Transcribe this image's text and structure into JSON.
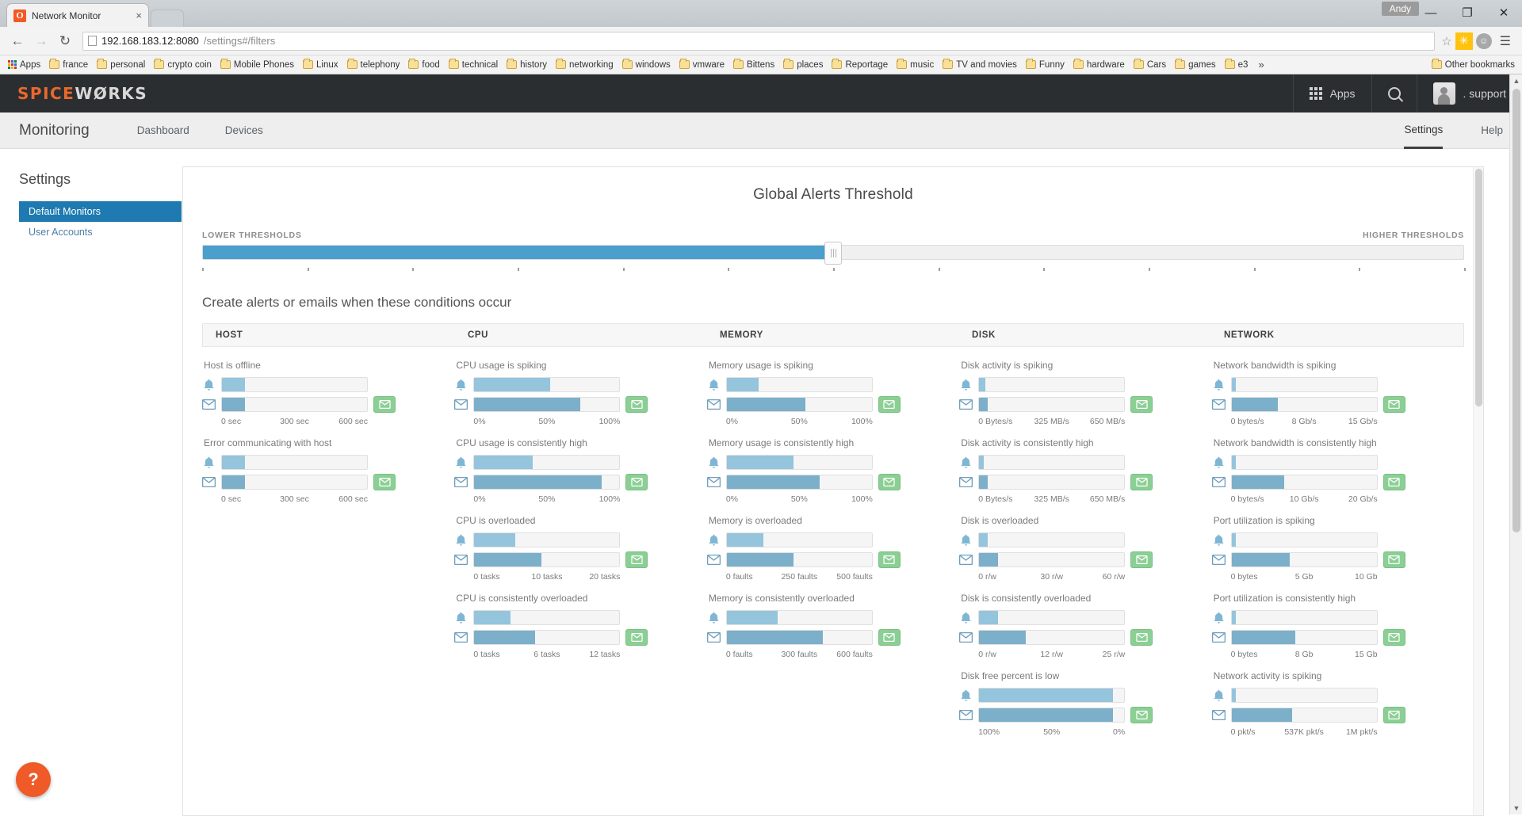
{
  "browser": {
    "tab_title": "Network Monitor",
    "tab_close": "×",
    "favicon_letter": "O",
    "window_user": "Andy",
    "minimize": "—",
    "maximize": "❐",
    "close": "✕",
    "back": "←",
    "forward": "→",
    "reload": "↻",
    "url_main": "192.168.183.12:8080",
    "url_dim": "/settings#/filters",
    "star": "☆",
    "ext_yellow_glyph": "✳",
    "ext_gray_glyph": "☺",
    "menu": "☰",
    "bookmarks": [
      "Apps",
      "france",
      "personal",
      "crypto coin",
      "Mobile Phones",
      "Linux",
      "telephony",
      "food",
      "technical",
      "history",
      "networking",
      "windows",
      "vmware",
      "Bittens",
      "places",
      "Reportage",
      "music",
      "TV and movies",
      "Funny",
      "hardware",
      "Cars",
      "games",
      "e3"
    ],
    "bookmarks_overflow": "»",
    "other_bookmarks": "Other bookmarks"
  },
  "sw_header": {
    "logo_orange": "SPICE",
    "logo_white": "WØRKS",
    "apps_label": "Apps",
    "search_label": "",
    "support_label": ". support"
  },
  "subnav": {
    "page_title": "Monitoring",
    "left_links": [
      "Dashboard",
      "Devices"
    ],
    "right_links": [
      "Settings",
      "Help"
    ]
  },
  "sidebar": {
    "title": "Settings",
    "items": [
      {
        "label": "Default Monitors",
        "selected": true
      },
      {
        "label": "User Accounts",
        "selected": false
      }
    ]
  },
  "panel": {
    "title": "Global Alerts Threshold",
    "slider": {
      "lower_label": "LOWER THRESHOLDS",
      "higher_label": "HIGHER THRESHOLDS",
      "value_percent": 50,
      "tick_count": 13,
      "fill_color": "#4a9fcc"
    },
    "conditions_heading": "Create alerts or emails when these conditions occur",
    "columns": [
      {
        "header": "HOST",
        "cards": [
          {
            "title": "Host is offline",
            "alert_percent": 16,
            "email_percent": 16,
            "scale": [
              "0 sec",
              "300 sec",
              "600 sec"
            ],
            "has_email_button": true
          },
          {
            "title": "Error communicating with host",
            "alert_percent": 16,
            "email_percent": 16,
            "scale": [
              "0 sec",
              "300 sec",
              "600 sec"
            ],
            "has_email_button": true
          }
        ]
      },
      {
        "header": "CPU",
        "cards": [
          {
            "title": "CPU usage is spiking",
            "alert_percent": 52,
            "email_percent": 73,
            "scale": [
              "0%",
              "50%",
              "100%"
            ],
            "has_email_button": true
          },
          {
            "title": "CPU usage is consistently high",
            "alert_percent": 40,
            "email_percent": 88,
            "scale": [
              "0%",
              "50%",
              "100%"
            ],
            "has_email_button": true
          },
          {
            "title": "CPU is overloaded",
            "alert_percent": 28,
            "email_percent": 46,
            "scale": [
              "0 tasks",
              "10 tasks",
              "20 tasks"
            ],
            "has_email_button": true
          },
          {
            "title": "CPU is consistently overloaded",
            "alert_percent": 25,
            "email_percent": 42,
            "scale": [
              "0 tasks",
              "6 tasks",
              "12 tasks"
            ],
            "has_email_button": true
          }
        ]
      },
      {
        "header": "MEMORY",
        "cards": [
          {
            "title": "Memory usage is spiking",
            "alert_percent": 22,
            "email_percent": 54,
            "scale": [
              "0%",
              "50%",
              "100%"
            ],
            "has_email_button": true
          },
          {
            "title": "Memory usage is consistently high",
            "alert_percent": 46,
            "email_percent": 64,
            "scale": [
              "0%",
              "50%",
              "100%"
            ],
            "has_email_button": true
          },
          {
            "title": "Memory is overloaded",
            "alert_percent": 25,
            "email_percent": 46,
            "scale": [
              "0 faults",
              "250 faults",
              "500 faults"
            ],
            "has_email_button": true
          },
          {
            "title": "Memory is consistently overloaded",
            "alert_percent": 35,
            "email_percent": 66,
            "scale": [
              "0 faults",
              "300 faults",
              "600 faults"
            ],
            "has_email_button": true
          }
        ]
      },
      {
        "header": "DISK",
        "cards": [
          {
            "title": "Disk activity is spiking",
            "alert_percent": 4,
            "email_percent": 6,
            "scale": [
              "0 Bytes/s",
              "325 MB/s",
              "650 MB/s"
            ],
            "has_email_button": true
          },
          {
            "title": "Disk activity is consistently high",
            "alert_percent": 3,
            "email_percent": 6,
            "scale": [
              "0 Bytes/s",
              "325 MB/s",
              "650 MB/s"
            ],
            "has_email_button": true
          },
          {
            "title": "Disk is overloaded",
            "alert_percent": 6,
            "email_percent": 13,
            "scale": [
              "0 r/w",
              "30 r/w",
              "60 r/w"
            ],
            "has_email_button": true
          },
          {
            "title": "Disk is consistently overloaded",
            "alert_percent": 13,
            "email_percent": 32,
            "scale": [
              "0 r/w",
              "12 r/w",
              "25 r/w"
            ],
            "has_email_button": true
          },
          {
            "title": "Disk free percent is low",
            "alert_percent": 92,
            "email_percent": 92,
            "scale": [
              "100%",
              "50%",
              "0%"
            ],
            "has_email_button": true
          }
        ]
      },
      {
        "header": "NETWORK",
        "cards": [
          {
            "title": "Network bandwidth is spiking",
            "alert_percent": 3,
            "email_percent": 32,
            "scale": [
              "0 bytes/s",
              "8 Gb/s",
              "15 Gb/s"
            ],
            "has_email_button": true
          },
          {
            "title": "Network bandwidth is consistently high",
            "alert_percent": 3,
            "email_percent": 36,
            "scale": [
              "0 bytes/s",
              "10 Gb/s",
              "20 Gb/s"
            ],
            "has_email_button": true
          },
          {
            "title": "Port utilization is spiking",
            "alert_percent": 3,
            "email_percent": 40,
            "scale": [
              "0 bytes",
              "5 Gb",
              "10 Gb"
            ],
            "has_email_button": true
          },
          {
            "title": "Port utilization is consistently high",
            "alert_percent": 3,
            "email_percent": 44,
            "scale": [
              "0 bytes",
              "8 Gb",
              "15 Gb"
            ],
            "has_email_button": true
          },
          {
            "title": "Network activity is spiking",
            "alert_percent": 3,
            "email_percent": 42,
            "scale": [
              "0 pkt/s",
              "537K pkt/s",
              "1M pkt/s"
            ],
            "has_email_button": true
          }
        ]
      }
    ]
  },
  "help_fab": {
    "glyph": "?"
  },
  "scroll": {
    "up_arrow": "▲",
    "down_arrow": "▼"
  }
}
